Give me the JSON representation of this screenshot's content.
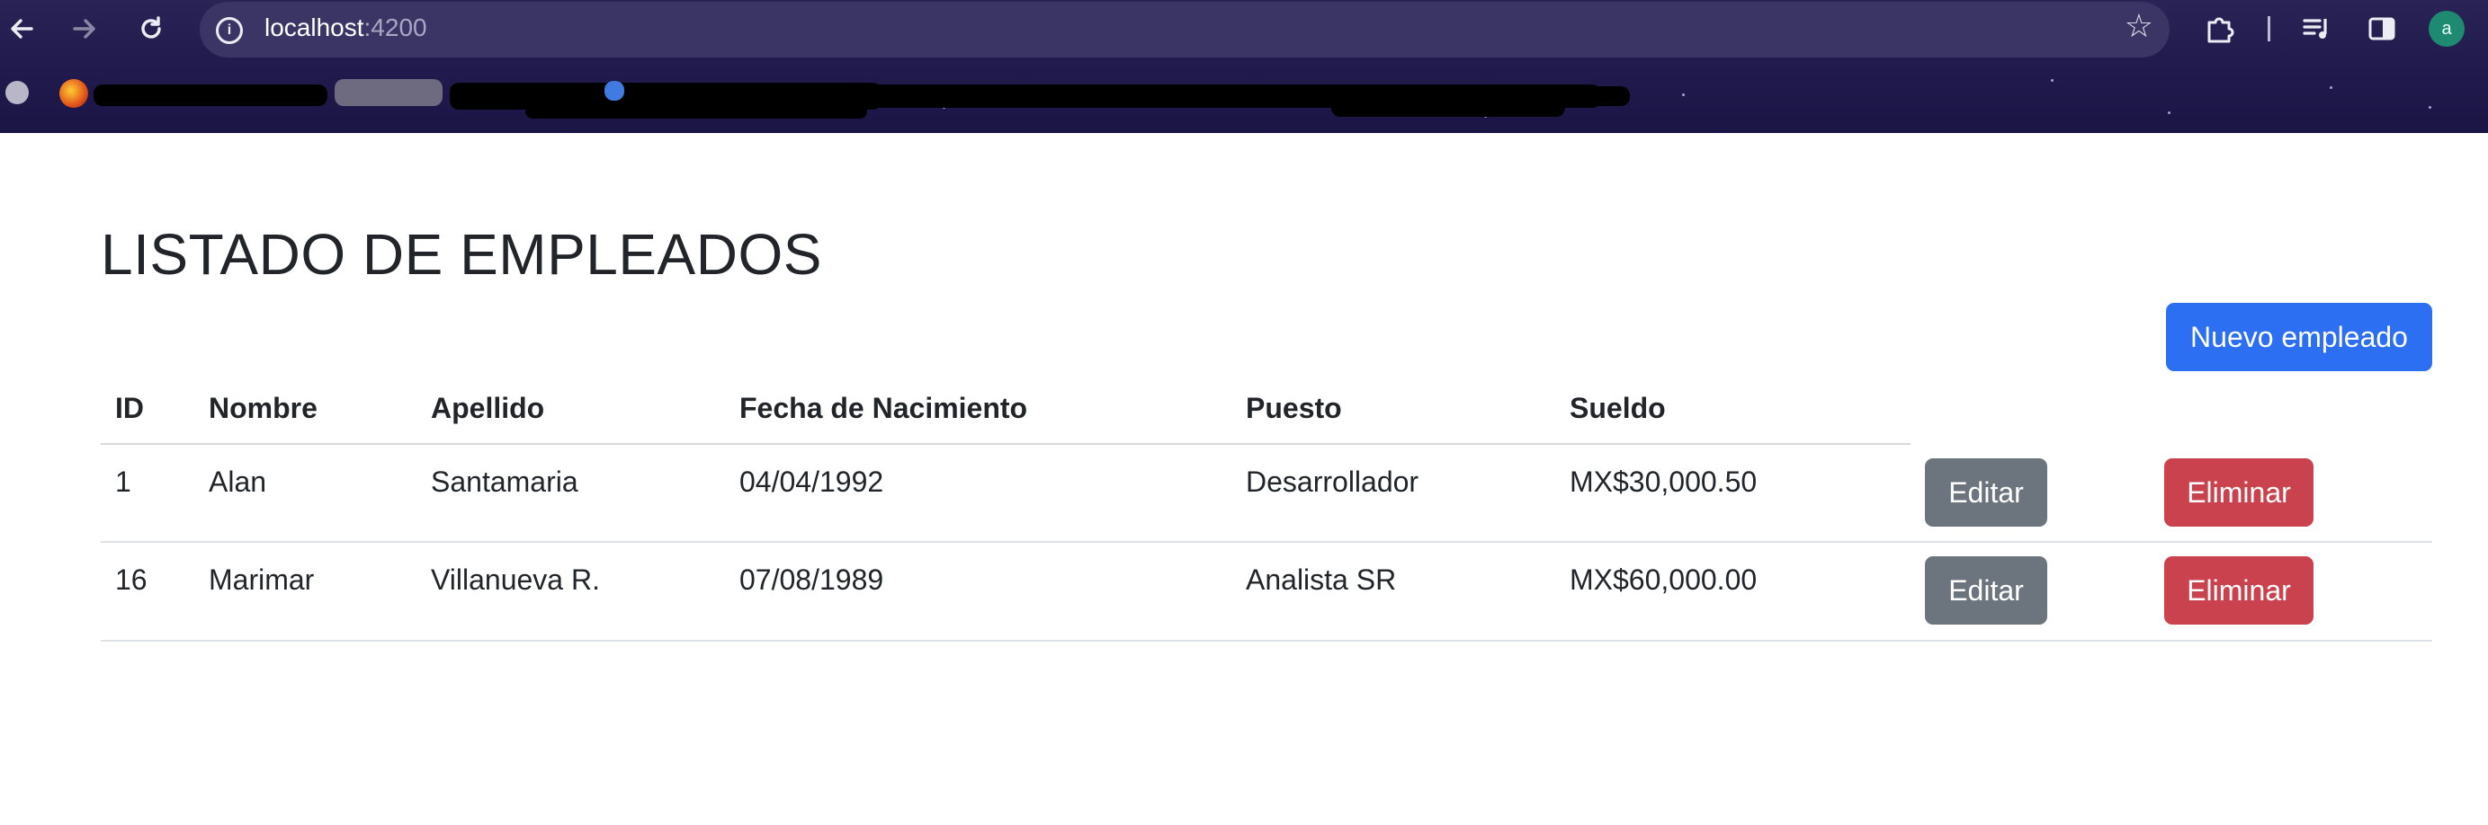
{
  "browser": {
    "url_host": "localhost",
    "url_port": ":4200",
    "profile_initial": "a",
    "icons": {
      "back": "back-arrow-icon",
      "forward": "forward-arrow-icon",
      "reload": "reload-icon",
      "site_info": "info-icon",
      "bookmark": "star-icon",
      "extensions": "puzzle-icon",
      "media": "media-control-icon",
      "side_panel": "side-panel-icon"
    }
  },
  "page": {
    "title": "LISTADO DE EMPLEADOS",
    "new_button": "Nuevo empleado",
    "columns": [
      "ID",
      "Nombre",
      "Apellido",
      "Fecha de Nacimiento",
      "Puesto",
      "Sueldo"
    ],
    "rows": [
      {
        "id": "1",
        "nombre": "Alan",
        "apellido": "Santamaria",
        "fecha": "04/04/1992",
        "puesto": "Desarrollador",
        "sueldo": "MX$30,000.50",
        "edit": "Editar",
        "delete": "Eliminar"
      },
      {
        "id": "16",
        "nombre": "Marimar",
        "apellido": "Villanueva R.",
        "fecha": "07/08/1989",
        "puesto": "Analista SR",
        "sueldo": "MX$60,000.00",
        "edit": "Editar",
        "delete": "Eliminar"
      }
    ]
  },
  "colors": {
    "primary": "#2d6ff2",
    "secondary": "#6c757d",
    "danger": "#c9424e",
    "chrome_bg": "#221c4e"
  }
}
